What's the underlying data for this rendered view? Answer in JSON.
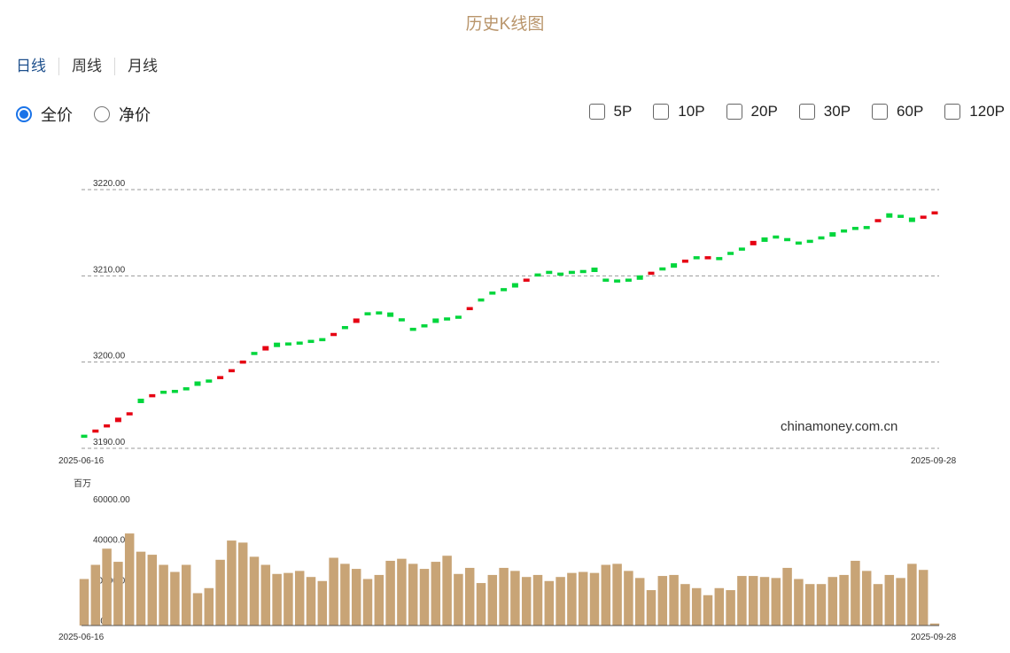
{
  "header": {
    "title": "历史K线图"
  },
  "period_tabs": [
    {
      "label": "日线"
    },
    {
      "label": "周线"
    },
    {
      "label": "月线"
    }
  ],
  "price_modes": [
    {
      "label": "全价",
      "checked": true
    },
    {
      "label": "净价",
      "checked": false
    }
  ],
  "ma_options": [
    {
      "label": "5P"
    },
    {
      "label": "10P"
    },
    {
      "label": "20P"
    },
    {
      "label": "30P"
    },
    {
      "label": "60P"
    },
    {
      "label": "120P"
    }
  ],
  "watermark": "chinamoney.com.cn",
  "colors": {
    "up": "#e60012",
    "down": "#00d63c",
    "volume": "#c8a476",
    "title": "#b9956b",
    "accent": "#1a73e8"
  },
  "chart_data": [
    {
      "type": "candlestick",
      "y_ticks": [
        "3190.00",
        "3200.00",
        "3210.00",
        "3220.00"
      ],
      "ylim": [
        3190,
        3220
      ],
      "x_start_label": "2025-06-16",
      "x_end_label": "2025-09-28",
      "grid": "horizontal dashed",
      "values": [
        3191.4,
        3192.0,
        3192.6,
        3193.3,
        3194.0,
        3195.5,
        3196.1,
        3196.5,
        3196.6,
        3196.9,
        3197.5,
        3197.8,
        3198.2,
        3199.0,
        3200.0,
        3201.0,
        3201.6,
        3202.0,
        3202.1,
        3202.2,
        3202.4,
        3202.6,
        3203.2,
        3204.0,
        3204.8,
        3205.6,
        3205.7,
        3205.5,
        3204.9,
        3203.8,
        3204.2,
        3204.8,
        3205.0,
        3205.2,
        3206.2,
        3207.2,
        3208.0,
        3208.4,
        3208.9,
        3209.5,
        3210.1,
        3210.4,
        3210.2,
        3210.4,
        3210.5,
        3210.7,
        3209.5,
        3209.4,
        3209.5,
        3209.8,
        3210.3,
        3210.8,
        3211.2,
        3211.7,
        3212.1,
        3212.1,
        3212.0,
        3212.6,
        3213.1,
        3213.8,
        3214.2,
        3214.5,
        3214.2,
        3213.8,
        3214.0,
        3214.4,
        3214.8,
        3215.2,
        3215.5,
        3215.6,
        3216.4,
        3217.0,
        3216.9,
        3216.5,
        3216.8,
        3217.3
      ],
      "direction": [
        "down",
        "up",
        "up",
        "up",
        "up",
        "down",
        "up",
        "down",
        "down",
        "down",
        "down",
        "down",
        "up",
        "up",
        "up",
        "down",
        "up",
        "down",
        "down",
        "down",
        "down",
        "down",
        "up",
        "down",
        "up",
        "down",
        "down",
        "down",
        "down",
        "down",
        "down",
        "down",
        "down",
        "down",
        "up",
        "down",
        "down",
        "down",
        "down",
        "up",
        "down",
        "down",
        "down",
        "down",
        "down",
        "down",
        "down",
        "down",
        "down",
        "down",
        "up",
        "down",
        "down",
        "up",
        "down",
        "up",
        "down",
        "down",
        "down",
        "up",
        "down",
        "down",
        "down",
        "down",
        "down",
        "down",
        "down",
        "down",
        "down",
        "down",
        "up",
        "down",
        "down",
        "down",
        "up",
        "up"
      ]
    },
    {
      "type": "bar",
      "unit": "百万",
      "y_ticks": [
        "0.00",
        "20000.00",
        "40000.00",
        "60000.00"
      ],
      "ylim": [
        0,
        60000
      ],
      "x_start_label": "2025-06-16",
      "x_end_label": "2025-09-28",
      "values": [
        23000,
        30000,
        38000,
        31500,
        45500,
        36500,
        35000,
        30000,
        26500,
        30000,
        16000,
        18500,
        32500,
        42000,
        41000,
        34000,
        30000,
        25500,
        26000,
        27000,
        24000,
        22000,
        33500,
        30500,
        28000,
        23000,
        25000,
        32000,
        33000,
        30500,
        28000,
        31500,
        34500,
        25500,
        28500,
        21000,
        25000,
        28500,
        27000,
        24000,
        25000,
        22000,
        24000,
        26000,
        26500,
        26000,
        30000,
        30500,
        27000,
        23500,
        17500,
        24500,
        25000,
        20500,
        18500,
        15000,
        18500,
        17500,
        24500,
        24500,
        24000,
        23500,
        28500,
        23000,
        20500,
        20500,
        24000,
        25000,
        32000,
        27000,
        20500,
        25000,
        23500,
        30500,
        27500,
        1000
      ]
    }
  ]
}
